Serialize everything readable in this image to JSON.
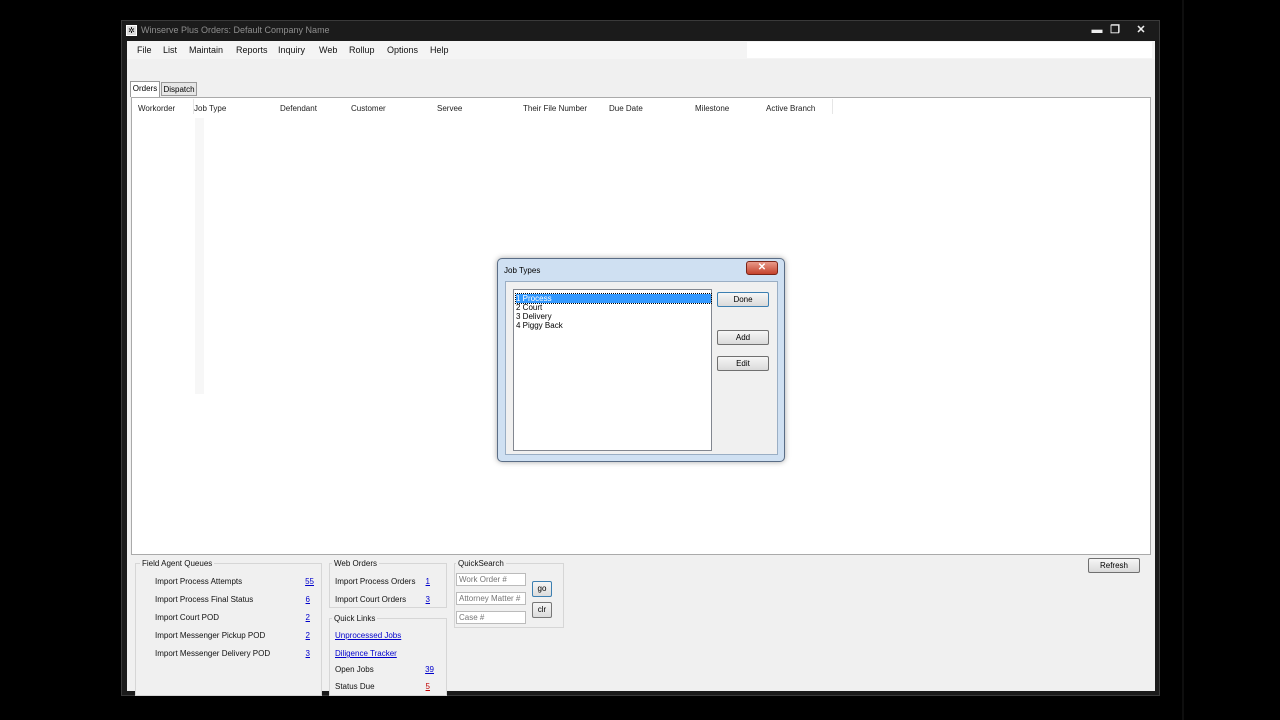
{
  "window": {
    "title": "Winserve Plus Orders: Default Company Name",
    "controls": {
      "minimize": "▬",
      "maximize": "❐",
      "close": "✕"
    }
  },
  "menu": [
    "File",
    "List",
    "Maintain",
    "Reports",
    "Inquiry",
    "Web",
    "Rollup",
    "Options",
    "Help"
  ],
  "tabs": [
    "Orders",
    "Dispatch"
  ],
  "grid": {
    "columns": [
      "Workorder",
      "Job Type",
      "Defendant",
      "Customer",
      "Servee",
      "Their File Number",
      "Due Date",
      "Milestone",
      "Active Branch"
    ]
  },
  "field_agent_queues": {
    "title": "Field Agent Queues",
    "rows": [
      {
        "label": "Import Process Attempts",
        "count": "55"
      },
      {
        "label": "Import Process Final Status",
        "count": "6"
      },
      {
        "label": "Import Court POD",
        "count": "2"
      },
      {
        "label": "Import Messenger Pickup POD",
        "count": "2"
      },
      {
        "label": "Import Messenger Delivery POD",
        "count": "3"
      }
    ]
  },
  "web_orders": {
    "title": "Web Orders",
    "rows": [
      {
        "label": "Import Process Orders",
        "count": "1"
      },
      {
        "label": "Import Court Orders",
        "count": "3"
      }
    ]
  },
  "quick_links": {
    "title": "Quick Links",
    "links": [
      "Unprocessed Jobs",
      "Diligence Tracker"
    ],
    "rows": [
      {
        "label": "Open Jobs",
        "count": "39"
      },
      {
        "label": "Status Due",
        "count": "5"
      }
    ]
  },
  "quick_search": {
    "title": "QuickSearch",
    "placeholders": [
      "Work Order #",
      "Attorney Matter #",
      "Case #"
    ],
    "go_label": "go",
    "clr_label": "clr"
  },
  "refresh_label": "Refresh",
  "dialog": {
    "title": "Job Types",
    "close": "✕",
    "items": [
      "1 Process",
      "2 Court",
      "3 Delivery",
      "4 Piggy Back"
    ],
    "selected": "1 Process",
    "done_label": "Done",
    "add_label": "Add",
    "edit_label": "Edit"
  }
}
